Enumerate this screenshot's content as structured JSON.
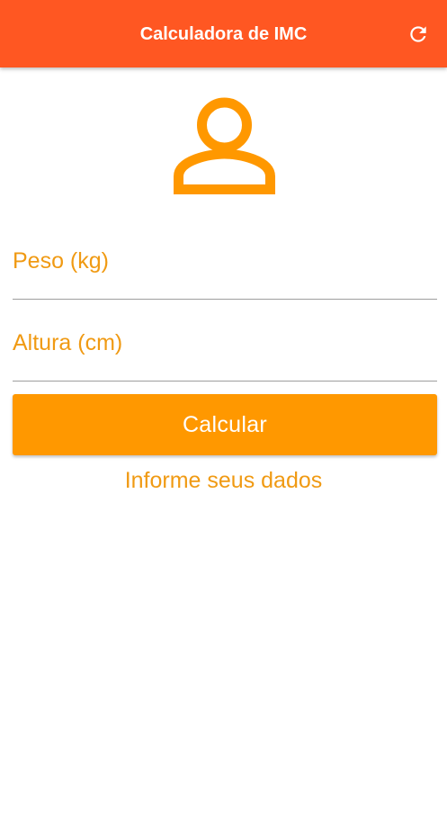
{
  "app_bar": {
    "title": "Calculadora de IMC",
    "refresh_icon": "refresh-icon",
    "color": "#ff5722"
  },
  "avatar": {
    "icon": "person-outline-icon",
    "color": "#ff9800"
  },
  "form": {
    "weight": {
      "placeholder": "Peso (kg)",
      "value": ""
    },
    "height": {
      "placeholder": "Altura (cm)",
      "value": ""
    },
    "calculate_label": "Calcular",
    "accent_color": "#ff9800"
  },
  "result": {
    "text": "Informe seus dados"
  }
}
